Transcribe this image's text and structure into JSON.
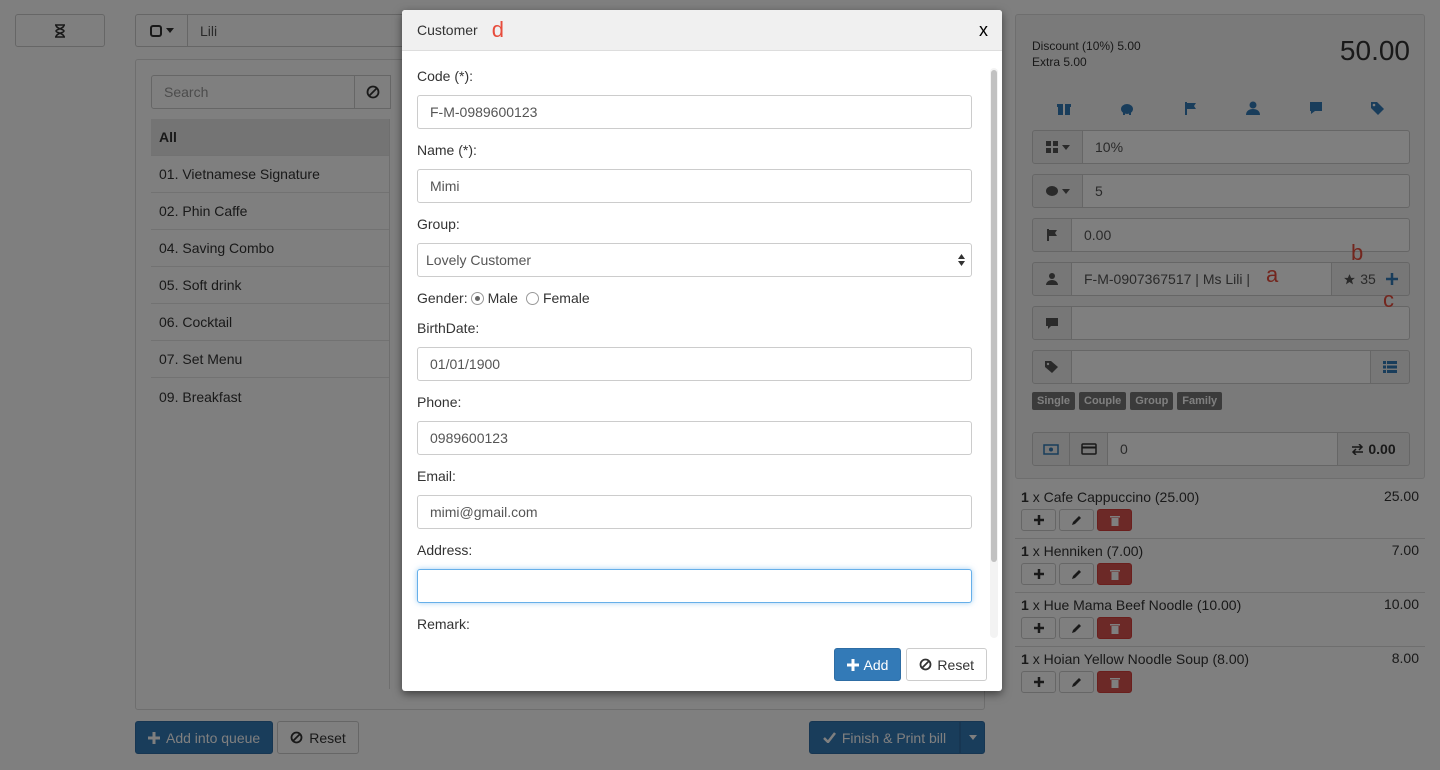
{
  "toolbar": {
    "customer_value": "Lili"
  },
  "search": {
    "placeholder": "Search"
  },
  "categories": [
    "All",
    "01. Vietnamese Signature",
    "02. Phin Caffe",
    "04. Saving Combo",
    "05. Soft drink",
    "06. Cocktail",
    "07. Set Menu",
    "09. Breakfast"
  ],
  "bottom": {
    "add_queue_label": "Add into queue",
    "reset_label": "Reset",
    "finish_label": "Finish & Print bill"
  },
  "summary": {
    "discount_text": "Discount (10%) 5.00",
    "extra_text": "Extra 5.00",
    "total": "50.00",
    "discount_value": "10%",
    "extra_value": "5",
    "flag_value": "0.00",
    "customer_value": "F-M-0907367517 | Ms Lili |",
    "points": "35",
    "payment_value": "0",
    "change_value": "0.00",
    "tags": [
      "Single",
      "Couple",
      "Group",
      "Family"
    ]
  },
  "orders": [
    {
      "qty": "1",
      "name": "x Cafe Cappuccino (25.00)",
      "price": "25.00"
    },
    {
      "qty": "1",
      "name": "x Henniken (7.00)",
      "price": "7.00"
    },
    {
      "qty": "1",
      "name": "x Hue Mama Beef Noodle (10.00)",
      "price": "10.00"
    },
    {
      "qty": "1",
      "name": "x Hoian Yellow Noodle Soup (8.00)",
      "price": "8.00"
    }
  ],
  "annotations": {
    "a": "a",
    "b": "b",
    "c": "c",
    "d": "d"
  },
  "modal": {
    "title": "Customer",
    "close": "x",
    "code_label": "Code (*):",
    "code_value": "F-M-0989600123",
    "name_label": "Name (*):",
    "name_value": "Mimi",
    "group_label": "Group:",
    "group_value": "Lovely Customer",
    "gender_label": "Gender:",
    "gender_male": "Male",
    "gender_female": "Female",
    "birth_label": "BirthDate:",
    "birth_value": "01/01/1900",
    "phone_label": "Phone:",
    "phone_value": "0989600123",
    "email_label": "Email:",
    "email_value": "mimi@gmail.com",
    "address_label": "Address:",
    "address_value": "",
    "remark_label": "Remark:",
    "add_label": "Add",
    "reset_label": "Reset"
  },
  "colors": {
    "primary": "#337ab7",
    "danger": "#d9534f",
    "annotation": "#e74c3c"
  }
}
